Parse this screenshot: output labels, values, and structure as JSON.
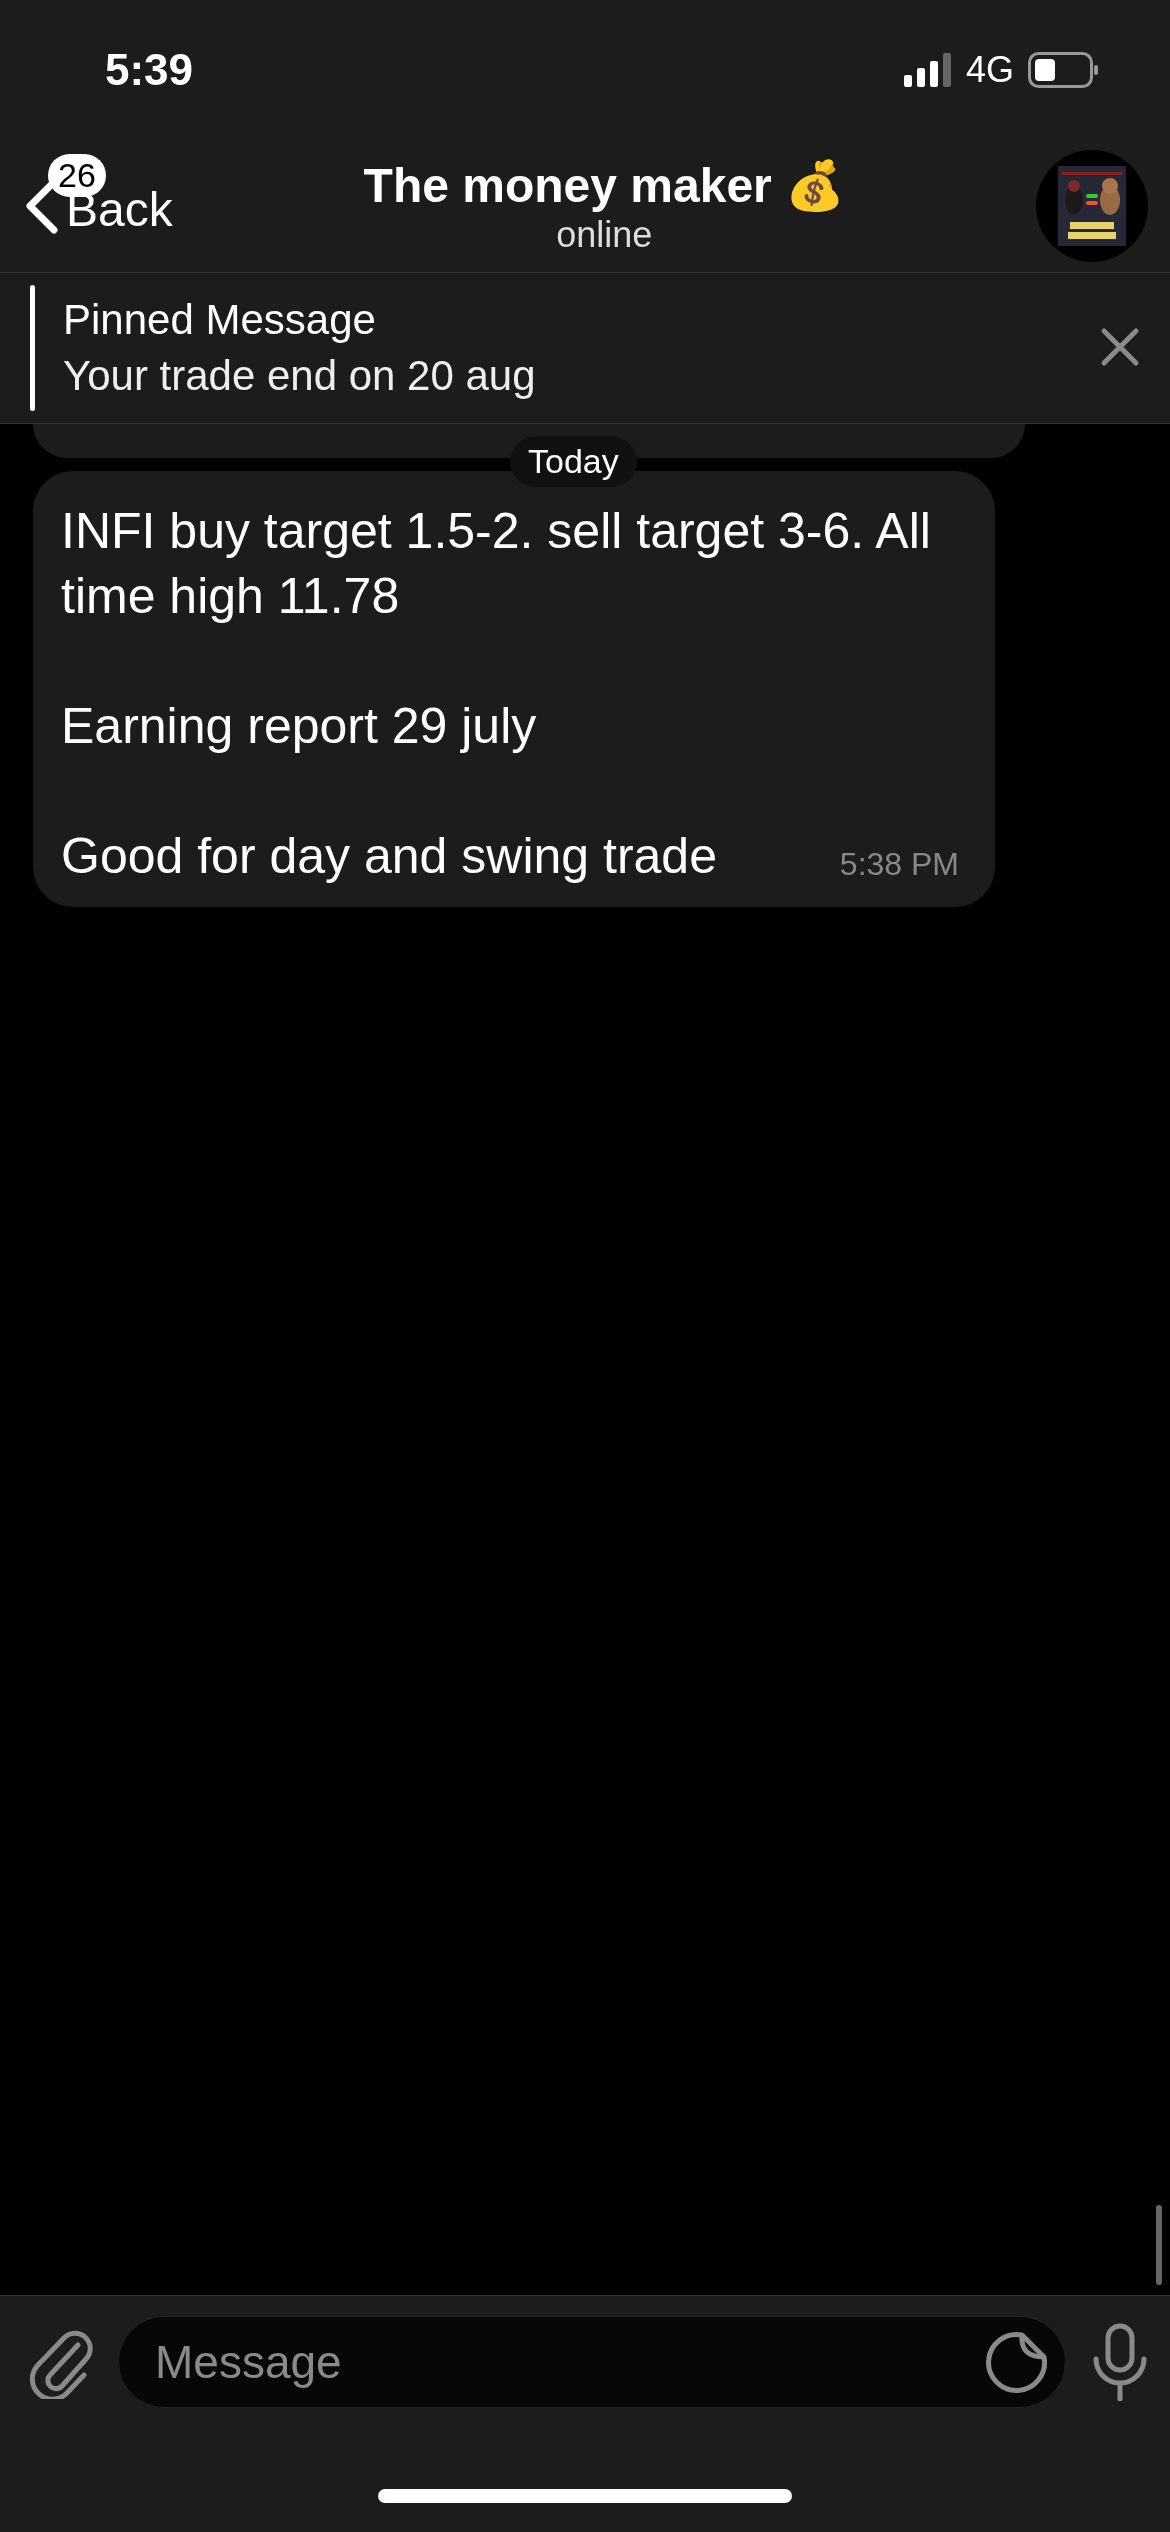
{
  "status_bar": {
    "time": "5:39",
    "network": "4G"
  },
  "header": {
    "back_label": "Back",
    "unread_count": "26",
    "title": "The money maker 💰",
    "subtitle": "online"
  },
  "pinned": {
    "title": "Pinned Message",
    "text": "Your trade end on 20 aug"
  },
  "date_badge": "Today",
  "message": {
    "paragraphs": [
      "INFI buy target 1.5-2. sell target 3-6. All time high 11.78",
      "Earning report 29 july",
      "Good for day and swing trade"
    ],
    "time": "5:38 PM"
  },
  "composer": {
    "placeholder": "Message"
  }
}
